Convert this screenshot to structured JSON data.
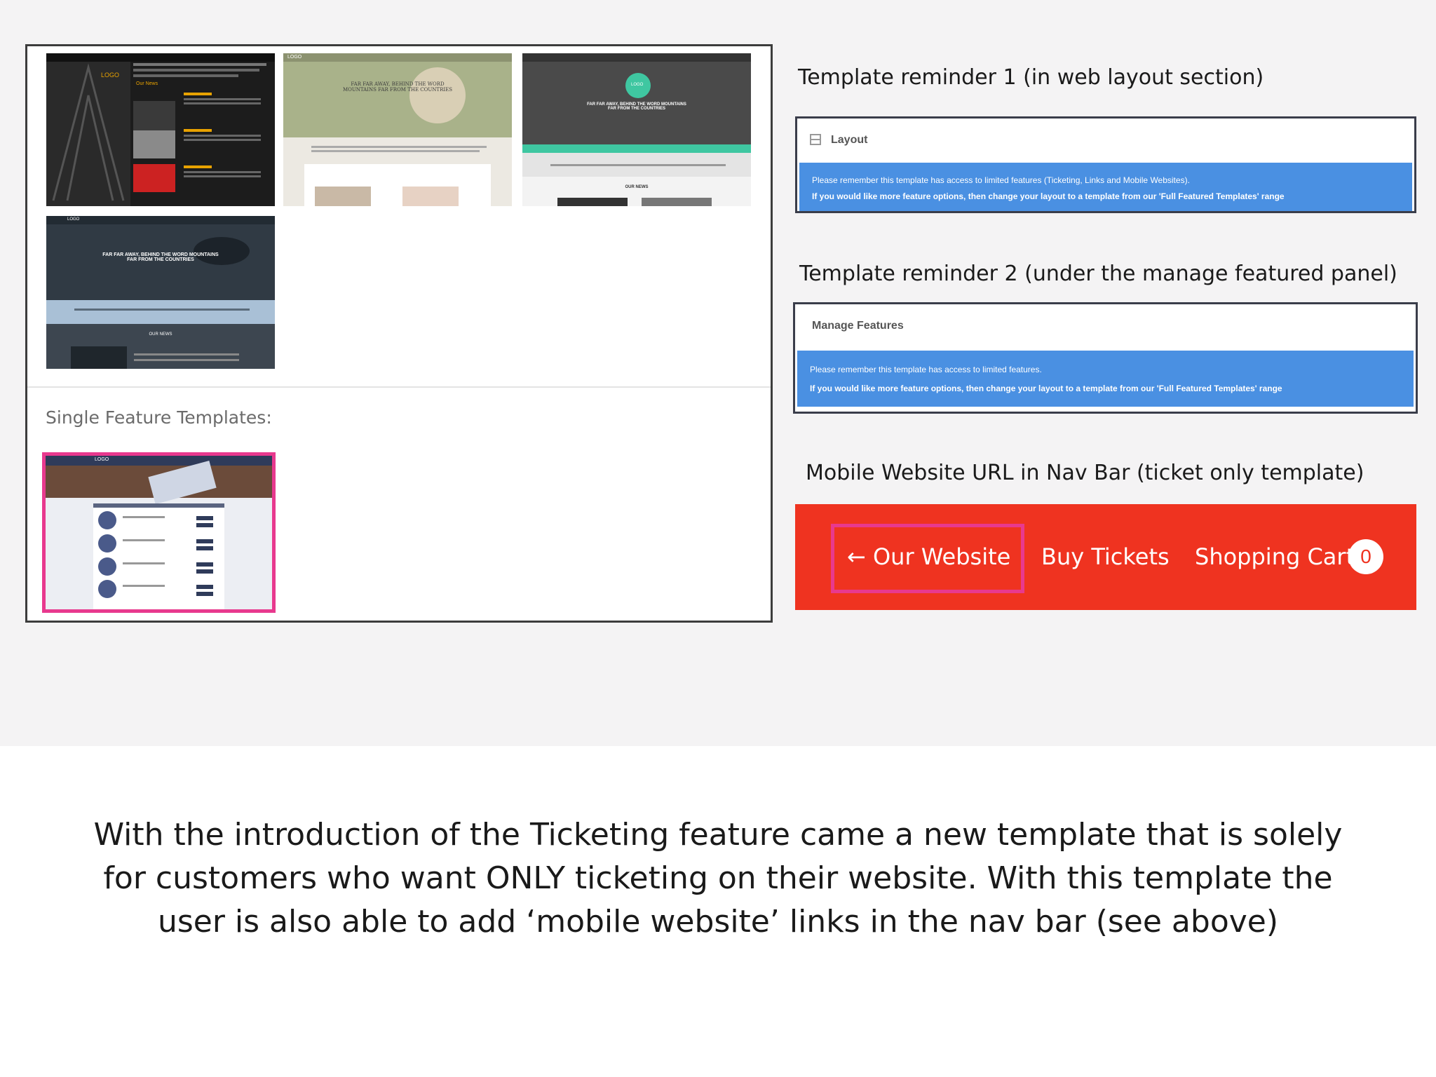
{
  "gallery": {
    "section_label": "Single Feature Templates:",
    "thumbnails": [
      {
        "logo": "LOGO",
        "heading": "",
        "subheading": "Our News"
      },
      {
        "logo": "LOGO",
        "heading": "FAR FAR AWAY, BEHIND THE WORD",
        "subheading": "MOUNTAINS FAR FROM THE COUNTRIES"
      },
      {
        "logo": "LOGO",
        "heading": "FAR FAR AWAY, BEHIND THE WORD MOUNTAINS",
        "subheading": "FAR FROM THE COUNTRIES"
      },
      {
        "logo": "LOGO",
        "heading": "FAR FAR AWAY, BEHIND THE WORD MOUNTAINS",
        "subheading": "FAR FROM THE COUNTRIES"
      },
      {
        "logo": "LOGO",
        "heading": "",
        "subheading": ""
      }
    ],
    "thumb_news_labels": [
      "OUR NEWS",
      "OUR NEWS",
      "OUR NEWS"
    ]
  },
  "reminder1": {
    "caption": "Template reminder 1 (in web layout section)",
    "header": "Layout",
    "line1": "Please remember this template has access to limited features (Ticketing, Links and Mobile Websites).",
    "line2": "If you would like more feature options, then change your layout to a template from our 'Full Featured Templates' range"
  },
  "reminder2": {
    "caption": "Template reminder 2 (under the manage featured panel)",
    "header": "Manage Features",
    "line1": "Please remember this template has access to limited features.",
    "line2": "If you would like more feature options, then change your layout to a template from our 'Full Featured Templates' range"
  },
  "mobile_nav": {
    "caption": "Mobile Website URL in Nav Bar (ticket only template)",
    "back_link": "← Our Website",
    "buy_tickets": "Buy Tickets",
    "shopping_cart": "Shopping Cart",
    "cart_count": "0"
  },
  "description": {
    "line1": "With the introduction of the Ticketing feature came a new template that is solely",
    "line2": "for customers who want ONLY ticketing on their website. With this template the",
    "line3": "user is also able to add ‘mobile website’ links in the nav bar (see above)"
  },
  "colors": {
    "slide_bg": "#f4f3f4",
    "info_blue": "#4a90e2",
    "nav_red": "#ef3320",
    "highlight_pink": "#e8398e"
  }
}
